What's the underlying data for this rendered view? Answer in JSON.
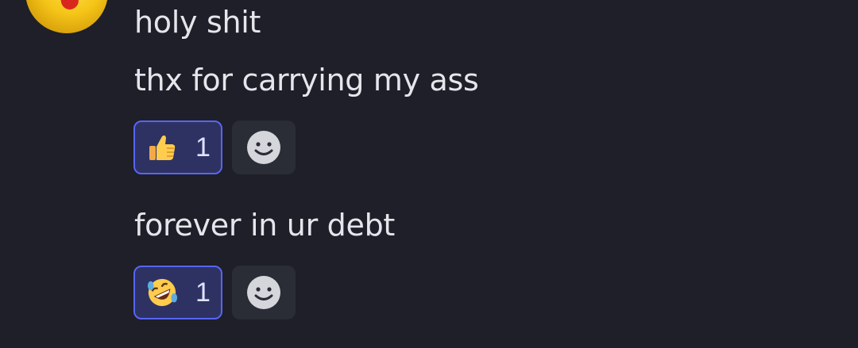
{
  "avatar": {
    "icon": "yellow-bird-avatar"
  },
  "messages": [
    {
      "text": "holy shit"
    },
    {
      "text": "thx for carrying my ass"
    },
    {
      "text": "forever in ur debt"
    }
  ],
  "reactions": [
    {
      "emoji": "thumbs-up",
      "count": "1",
      "add_icon": "smiley-add-reaction-icon"
    },
    {
      "emoji": "rolling-on-floor-laughing",
      "count": "1",
      "add_icon": "smiley-add-reaction-icon"
    }
  ],
  "colors": {
    "background": "#1e1f28",
    "reaction_active_bg": "#2e3263",
    "reaction_active_border": "#5865f2",
    "add_reaction_bg": "#2a2c36"
  }
}
